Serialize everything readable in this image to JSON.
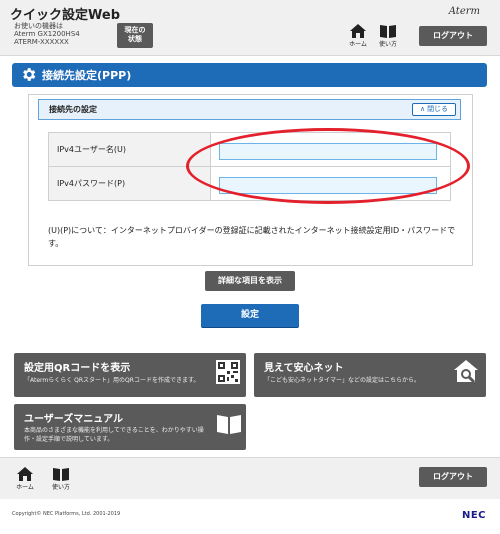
{
  "header": {
    "app_title": "クイック設定Web",
    "device_lines": [
      "お使いの機器は",
      "Aterm GX1200HS4",
      "ATERM-XXXXXX"
    ],
    "status_button": [
      "現在の",
      "状態"
    ],
    "brand": "Aterm",
    "home_label": "ホーム",
    "help_label": "使い方",
    "logout_label": "ログアウト"
  },
  "section": {
    "title": "接続先設定(PPP)"
  },
  "panel": {
    "heading": "接続先の設定",
    "close_label": "閉じる",
    "fields": [
      {
        "label": "IPv4ユーザー名(U)",
        "value": ""
      },
      {
        "label": "IPv4パスワード(P)",
        "value": ""
      }
    ],
    "note": "(U)(P)について：インターネットプロバイダーの登録証に記載されたインターネット接続設定用ID・パスワードです。"
  },
  "actions": {
    "detail_label": "詳細な項目を表示",
    "apply_label": "設定"
  },
  "cards": [
    {
      "title": "設定用QRコードを表示",
      "desc": "「Atermらくらく QRスタート」用のQRコードを作成できます。",
      "icon": "qr-code-icon"
    },
    {
      "title": "見えて安心ネット",
      "desc": "「こども安心ネットタイマー」などの設定はこちらから。",
      "icon": "home-search-icon"
    },
    {
      "title": "ユーザーズマニュアル",
      "desc": [
        "本商品のさまざまな機能を利用してできることを、わかりやすい操",
        "作・設定手順で説明しています。"
      ],
      "icon": "book-icon"
    }
  ],
  "footer": {
    "home_label": "ホーム",
    "help_label": "使い方",
    "logout_label": "ログアウト",
    "copyright": "Copyright© NEC Platforms, Ltd. 2001-2019",
    "logo": "NEC"
  },
  "colors": {
    "accent": "#1e6bb8",
    "dark_button": "#5a5a5a",
    "highlight": "#e3202b"
  }
}
